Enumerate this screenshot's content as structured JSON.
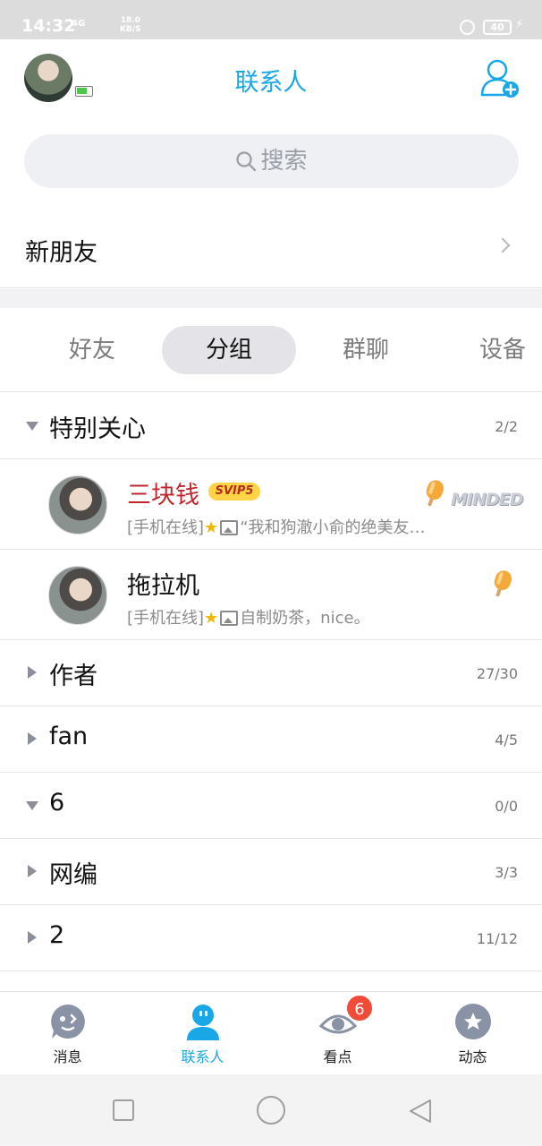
{
  "status_bar": {
    "time": "14:32",
    "signal": "4G",
    "net_speed": "18.0",
    "net_unit": "KB/S",
    "battery": "40"
  },
  "header": {
    "title": "联系人",
    "avatar_icon": "user-avatar",
    "add_icon": "add-user-icon"
  },
  "search": {
    "placeholder": "搜索",
    "icon": "search-icon"
  },
  "new_friends": {
    "label": "新朋友"
  },
  "tabs": [
    {
      "label": "好友",
      "active": false
    },
    {
      "label": "分组",
      "active": true
    },
    {
      "label": "群聊",
      "active": false
    },
    {
      "label": "设备",
      "active": false
    }
  ],
  "groups": {
    "special": {
      "name": "特别关心",
      "count": "2/2",
      "expanded": true
    },
    "authors": {
      "name": "作者",
      "count": "27/30",
      "expanded": false
    },
    "fan": {
      "name": "fan",
      "count": "4/5",
      "expanded": false
    },
    "six": {
      "name": "6",
      "count": "0/0",
      "expanded": true
    },
    "webeditor": {
      "name": "网编",
      "count": "3/3",
      "expanded": false
    },
    "two": {
      "name": "2",
      "count": "11/12",
      "expanded": false
    }
  },
  "contacts": [
    {
      "name": "三块钱",
      "badge": "SVIP5",
      "status": "[手机在线]",
      "message": "“我和狗澈小俞的绝美友…",
      "tag": "MINDED"
    },
    {
      "name": "拖拉机",
      "status": "[手机在线]",
      "message": "自制奶茶，nice。"
    }
  ],
  "bottom_nav": [
    {
      "label": "消息",
      "active": false
    },
    {
      "label": "联系人",
      "active": true
    },
    {
      "label": "看点",
      "active": false,
      "badge": "6"
    },
    {
      "label": "动态",
      "active": false
    }
  ],
  "colors": {
    "accent": "#1aa7e8",
    "vip_name": "#c1272d",
    "badge_red": "#f14b3a"
  }
}
